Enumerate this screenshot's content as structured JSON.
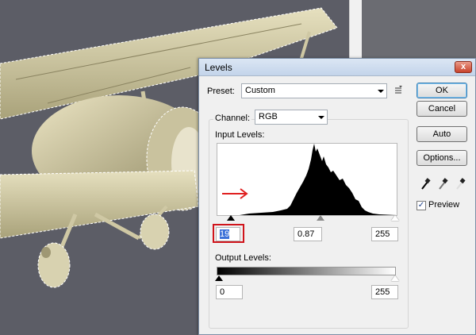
{
  "dialog": {
    "title": "Levels",
    "close_glyph": "x",
    "preset_label": "Preset:",
    "preset_value": "Custom",
    "channel_label": "Channel:",
    "channel_value": "RGB",
    "input_levels_label": "Input Levels:",
    "output_levels_label": "Output Levels:",
    "input_black": "19",
    "input_gamma": "0.87",
    "input_white": "255",
    "output_black": "0",
    "output_white": "255",
    "buttons": {
      "ok": "OK",
      "cancel": "Cancel",
      "auto": "Auto",
      "options": "Options..."
    },
    "preview_label": "Preview",
    "preview_checked": true
  },
  "icons": [
    "close-icon",
    "preset-menu-icon",
    "black-eyedropper-icon",
    "gray-eyedropper-icon",
    "white-eyedropper-icon",
    "red-arrow-icon"
  ],
  "colors": {
    "highlight_box": "#d0141b",
    "arrow": "#e02020",
    "selection_blue": "#3a6fd8"
  }
}
